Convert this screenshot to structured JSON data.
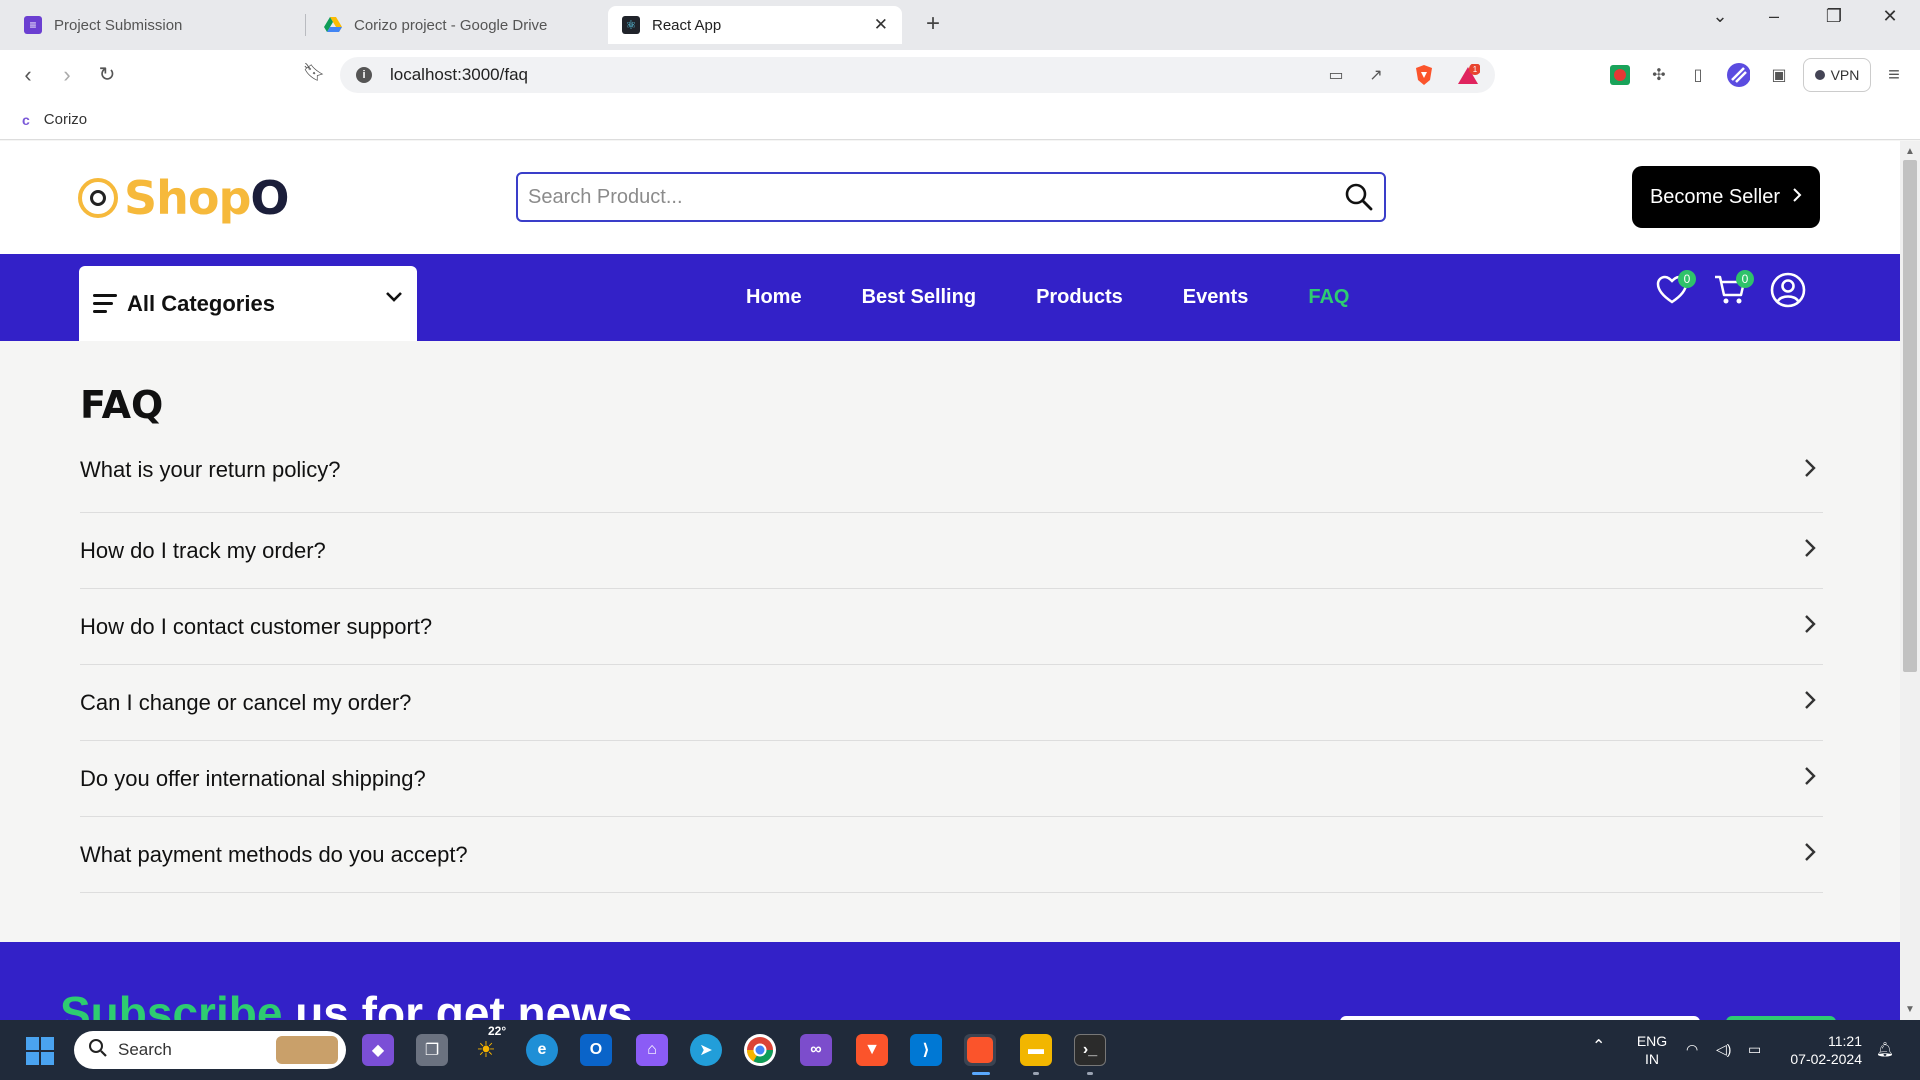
{
  "browser": {
    "tabs": [
      {
        "title": "Project Submission",
        "active": false
      },
      {
        "title": "Corizo project - Google Drive",
        "active": false
      },
      {
        "title": "React App",
        "active": true
      }
    ],
    "url": "localhost:3000/faq",
    "vpn_label": "VPN",
    "notification_count": "1",
    "bookmarks": [
      {
        "label": "Corizo"
      }
    ]
  },
  "header": {
    "logo_brand": "Shop",
    "logo_suffix": "O",
    "search_placeholder": "Search Product...",
    "seller_button": "Become Seller"
  },
  "nav": {
    "categories_label": "All Categories",
    "links": [
      {
        "label": "Home",
        "active": false
      },
      {
        "label": "Best Selling",
        "active": false
      },
      {
        "label": "Products",
        "active": false
      },
      {
        "label": "Events",
        "active": false
      },
      {
        "label": "FAQ",
        "active": true
      }
    ],
    "wishlist_count": "0",
    "cart_count": "0",
    "active_color": "#2ecc71",
    "bar_color": "#3321c8"
  },
  "faq": {
    "title": "FAQ",
    "questions": [
      "What is your return policy?",
      "How do I track my order?",
      "How do I contact customer support?",
      "Can I change or cancel my order?",
      "Do you offer international shipping?",
      "What payment methods do you accept?"
    ]
  },
  "subscribe": {
    "highlight": "Subscribe",
    "rest": " us for get news"
  },
  "taskbar": {
    "search_label": "Search",
    "weather": "22°",
    "lang_line1": "ENG",
    "lang_line2": "IN",
    "time": "11:21",
    "date": "07-02-2024"
  }
}
